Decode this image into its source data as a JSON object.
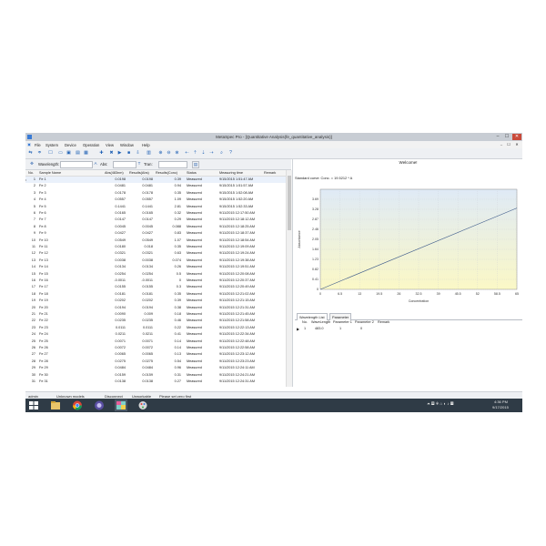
{
  "window": {
    "title": "MetaSpec Pro - [Quantitative Analysis(fe_quantitative_analysis)]",
    "min_glyph": "–",
    "max_glyph": "☐",
    "close_glyph": "✕",
    "mdi_min_glyph": "–",
    "mdi_max_glyph": "☐",
    "mdi_close_glyph": "✕"
  },
  "menu": [
    "File",
    "System",
    "Device",
    "Operation",
    "View",
    "Window",
    "Help"
  ],
  "toolbar_icons": [
    {
      "name": "connect-icon",
      "glyph": "⇆"
    },
    {
      "name": "scan-icon",
      "glyph": "≑"
    },
    {
      "name": "new-file-icon",
      "glyph": "☐"
    },
    {
      "name": "open-folder-icon",
      "glyph": "▭"
    },
    {
      "name": "save-icon",
      "glyph": "▣"
    },
    {
      "name": "print-icon",
      "glyph": "▤"
    },
    {
      "name": "grid-icon",
      "glyph": "▦"
    },
    {
      "name": "add-icon",
      "glyph": "✚"
    },
    {
      "name": "delete-icon",
      "glyph": "✖"
    },
    {
      "name": "play-icon",
      "glyph": "▶"
    },
    {
      "name": "stop-icon",
      "glyph": "■"
    },
    {
      "name": "export-icon",
      "glyph": "⇩"
    },
    {
      "name": "settings-icon",
      "glyph": "▥"
    },
    {
      "name": "zoom-in-icon",
      "glyph": "⊕"
    },
    {
      "name": "zoom-out-icon",
      "glyph": "⊖"
    },
    {
      "name": "zoom-fit-icon",
      "glyph": "⊗"
    },
    {
      "name": "arrow-left-icon",
      "glyph": "⇠"
    },
    {
      "name": "arrow-up-icon",
      "glyph": "⇡"
    },
    {
      "name": "arrow-down-icon",
      "glyph": "⇣"
    },
    {
      "name": "arrow-right-icon",
      "glyph": "⇢"
    },
    {
      "name": "search-icon",
      "glyph": "⌕"
    },
    {
      "name": "help-icon",
      "glyph": "?"
    }
  ],
  "measure_bar": {
    "wavelength_label": "Wavelength:",
    "abs_label": "Abs:",
    "trans_label": "Tran:"
  },
  "table": {
    "headers": [
      "No.",
      "Sample Name",
      "Abs(483nm)",
      "Results(Abs)",
      "Results(Conc)",
      "Status",
      "Measuring time",
      "Remark"
    ],
    "rows": [
      [
        "1",
        "Fe 1",
        "0.0198",
        "0.0198",
        "0.39",
        "Measured",
        "9/15/2015 1:51:47 AM"
      ],
      [
        "2",
        "Fe 2",
        "0.0481",
        "0.0481",
        "0.94",
        "Measured",
        "9/15/2015 1:51:57 AM"
      ],
      [
        "3",
        "Fe 3",
        "0.0178",
        "0.0178",
        "0.35",
        "Measured",
        "9/15/2015 1:52:08 AM"
      ],
      [
        "4",
        "Fe 4",
        "0.0557",
        "0.0557",
        "1.09",
        "Measured",
        "9/15/2015 1:52:20 AM"
      ],
      [
        "5",
        "Fe 5",
        "0.1441",
        "0.1441",
        "2.81",
        "Measured",
        "9/15/2015 1:52:33 AM"
      ],
      [
        "6",
        "Fe 6",
        "0.0165",
        "0.0165",
        "0.32",
        "Measured",
        "9/11/2015 12:17:50 AM"
      ],
      [
        "7",
        "Fe 7",
        "0.0147",
        "0.0147",
        "0.29",
        "Measured",
        "9/11/2015 12:18:12 AM"
      ],
      [
        "8",
        "Fe 8",
        "0.0045",
        "0.0045",
        "0.088",
        "Measured",
        "9/11/2015 12:18:25 AM"
      ],
      [
        "9",
        "Fe 9",
        "0.0427",
        "0.0427",
        "0.83",
        "Measured",
        "9/11/2015 12:18:37 AM"
      ],
      [
        "10",
        "Fe 10",
        "0.0549",
        "0.0549",
        "1.07",
        "Measured",
        "9/11/2015 12:18:54 AM"
      ],
      [
        "11",
        "Fe 11",
        "0.0180",
        "0.018",
        "0.35",
        "Measured",
        "9/11/2015 12:19:09 AM"
      ],
      [
        "12",
        "Fe 12",
        "0.0321",
        "0.0321",
        "0.63",
        "Measured",
        "9/11/2015 12:19:24 AM"
      ],
      [
        "13",
        "Fe 13",
        "0.0038",
        "0.0038",
        "0.074",
        "Measured",
        "9/11/2015 12:19:38 AM"
      ],
      [
        "14",
        "Fe 14",
        "0.0134",
        "0.0134",
        "0.26",
        "Measured",
        "9/11/2015 12:19:51 AM"
      ],
      [
        "15",
        "Fe 15",
        "0.0254",
        "0.0254",
        "0.5",
        "Measured",
        "9/11/2015 12:20:08 AM"
      ],
      [
        "16",
        "Fe 16",
        "-0.0011",
        "-0.0011",
        "0",
        "Measured",
        "9/11/2015 12:20:37 AM"
      ],
      [
        "17",
        "Fe 17",
        "0.0155",
        "0.0155",
        "0.3",
        "Measured",
        "9/11/2015 12:20:49 AM"
      ],
      [
        "18",
        "Fe 18",
        "0.0181",
        "0.0181",
        "0.35",
        "Measured",
        "9/11/2015 12:21:02 AM"
      ],
      [
        "19",
        "Fe 19",
        "0.0202",
        "0.0202",
        "0.39",
        "Measured",
        "9/11/2015 12:21:15 AM"
      ],
      [
        "20",
        "Fe 20",
        "0.0194",
        "0.0194",
        "0.38",
        "Measured",
        "9/11/2015 12:21:31 AM"
      ],
      [
        "21",
        "Fe 21",
        "0.0090",
        "0.009",
        "0.18",
        "Measured",
        "9/11/2015 12:21:45 AM"
      ],
      [
        "22",
        "Fe 22",
        "0.0235",
        "0.0235",
        "0.46",
        "Measured",
        "9/11/2015 12:21:58 AM"
      ],
      [
        "23",
        "Fe 23",
        "0.0111",
        "0.0111",
        "0.22",
        "Measured",
        "9/11/2015 12:22:13 AM"
      ],
      [
        "24",
        "Fe 24",
        "0.0211",
        "0.0211",
        "0.41",
        "Measured",
        "9/11/2015 12:22:34 AM"
      ],
      [
        "25",
        "Fe 25",
        "0.0071",
        "0.0071",
        "0.14",
        "Measured",
        "9/11/2015 12:22:48 AM"
      ],
      [
        "26",
        "Fe 26",
        "0.0072",
        "0.0072",
        "0.14",
        "Measured",
        "9/11/2015 12:22:58 AM"
      ],
      [
        "27",
        "Fe 27",
        "0.0065",
        "0.0065",
        "0.13",
        "Measured",
        "9/11/2015 12:23:12 AM"
      ],
      [
        "28",
        "Fe 28",
        "0.0275",
        "0.0275",
        "0.54",
        "Measured",
        "9/11/2015 12:23:23 AM"
      ],
      [
        "29",
        "Fe 29",
        "0.0484",
        "0.0484",
        "0.96",
        "Measured",
        "9/11/2015 12:24:11 AM"
      ],
      [
        "30",
        "Fe 30",
        "0.0159",
        "0.0159",
        "0.31",
        "Measured",
        "9/11/2015 12:24:21 AM"
      ],
      [
        "31",
        "Fe 31",
        "0.0138",
        "0.0138",
        "0.27",
        "Measured",
        "9/11/2015 12:24:31 AM"
      ]
    ]
  },
  "right_panel": {
    "welcome": "Welcome!",
    "standard_curve": "Standard curve: Conc. = 19.5212 * A",
    "tabs": [
      "Wavelength List",
      "Parameter"
    ],
    "wl_headers": [
      "No.",
      "WaveLength",
      "Parameter 1",
      "Parameter 2",
      "Remark"
    ],
    "wl_rows": [
      [
        "1",
        "483.0",
        "1",
        "0",
        ""
      ]
    ]
  },
  "chart_data": {
    "type": "line",
    "title": "",
    "xlabel": "Concentration",
    "ylabel": "Absorbance",
    "x_ticks": [
      "0",
      "6.5",
      "13",
      "19.5",
      "26",
      "32.5",
      "39",
      "45.5",
      "52",
      "58.5",
      "65"
    ],
    "y_ticks": [
      "0",
      "0.41",
      "0.82",
      "1.23",
      "1.64",
      "2.05",
      "2.46",
      "2.87",
      "3.28",
      "3.69"
    ],
    "xlim": [
      0,
      65
    ],
    "ylim": [
      0,
      4.1
    ],
    "series": [
      {
        "x": [
          0,
          65
        ],
        "y": [
          0,
          3.33
        ]
      }
    ],
    "grid": true,
    "line_color": "#3d5a8a"
  },
  "status_bar": [
    "admin",
    "Unknown models",
    "Disconnect",
    "Unworkable",
    "Please set zero first"
  ],
  "taskbar": {
    "time": "4:36 PM",
    "date": "9/17/2015"
  }
}
